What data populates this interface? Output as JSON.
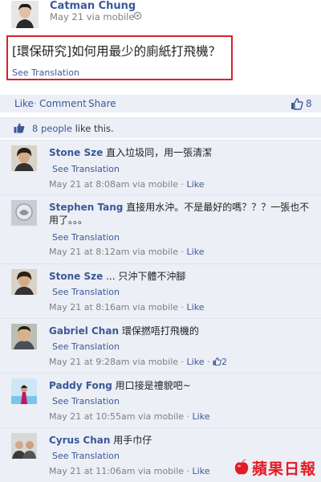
{
  "post": {
    "author": "Catman Chung",
    "meta": "May 21 via mobile",
    "text": "[環保研究]如何用最少的廁紙打飛機？",
    "see_translation": "See Translation"
  },
  "actions": {
    "like": "Like",
    "comment": "Comment",
    "share": "Share",
    "like_count": "8"
  },
  "likes_summary": {
    "people": "8 people",
    "suffix": " like this."
  },
  "comments": [
    {
      "name": "Stone Sze",
      "text": "直入垃圾同，用一張清潔",
      "text2": "",
      "see_translation": "See Translation",
      "time": "May 21 at 8:08am via mobile",
      "like": "Like",
      "like_count": ""
    },
    {
      "name": "Stephen Tang",
      "text": "直接用水沖。不是最好的嗎？？？一張也不",
      "text2": "用了。。。",
      "see_translation": "See Translation",
      "time": "May 21 at 8:12am via mobile",
      "like": "Like",
      "like_count": ""
    },
    {
      "name": "Stone Sze",
      "text": "... 只沖下體不沖腳",
      "text2": "",
      "see_translation": "See Translation",
      "time": "May 21 at 8:16am via mobile",
      "like": "Like",
      "like_count": ""
    },
    {
      "name": "Gabriel Chan",
      "text": "環保撚唔打飛機的",
      "text2": "",
      "see_translation": "See Translation",
      "time": "May 21 at 9:28am via mobile",
      "like": "Like",
      "like_count": "2"
    },
    {
      "name": "Paddy Fong",
      "text": "用口接是禮貌吧~",
      "text2": "",
      "see_translation": "See Translation",
      "time": "May 21 at 10:55am via mobile",
      "like": "Like",
      "like_count": ""
    },
    {
      "name": "Cyrus Chan",
      "text": "用手巾仔",
      "text2": "",
      "see_translation": "See Translation",
      "time": "May 21 at 11:06am via mobile",
      "like": "Like",
      "like_count": ""
    }
  ],
  "watermark": "蘋果日報",
  "colors": {
    "link": "#3b5998",
    "highlight_border": "#d7232d",
    "panel_bg": "#eceff5",
    "watermark": "#e31b23"
  }
}
